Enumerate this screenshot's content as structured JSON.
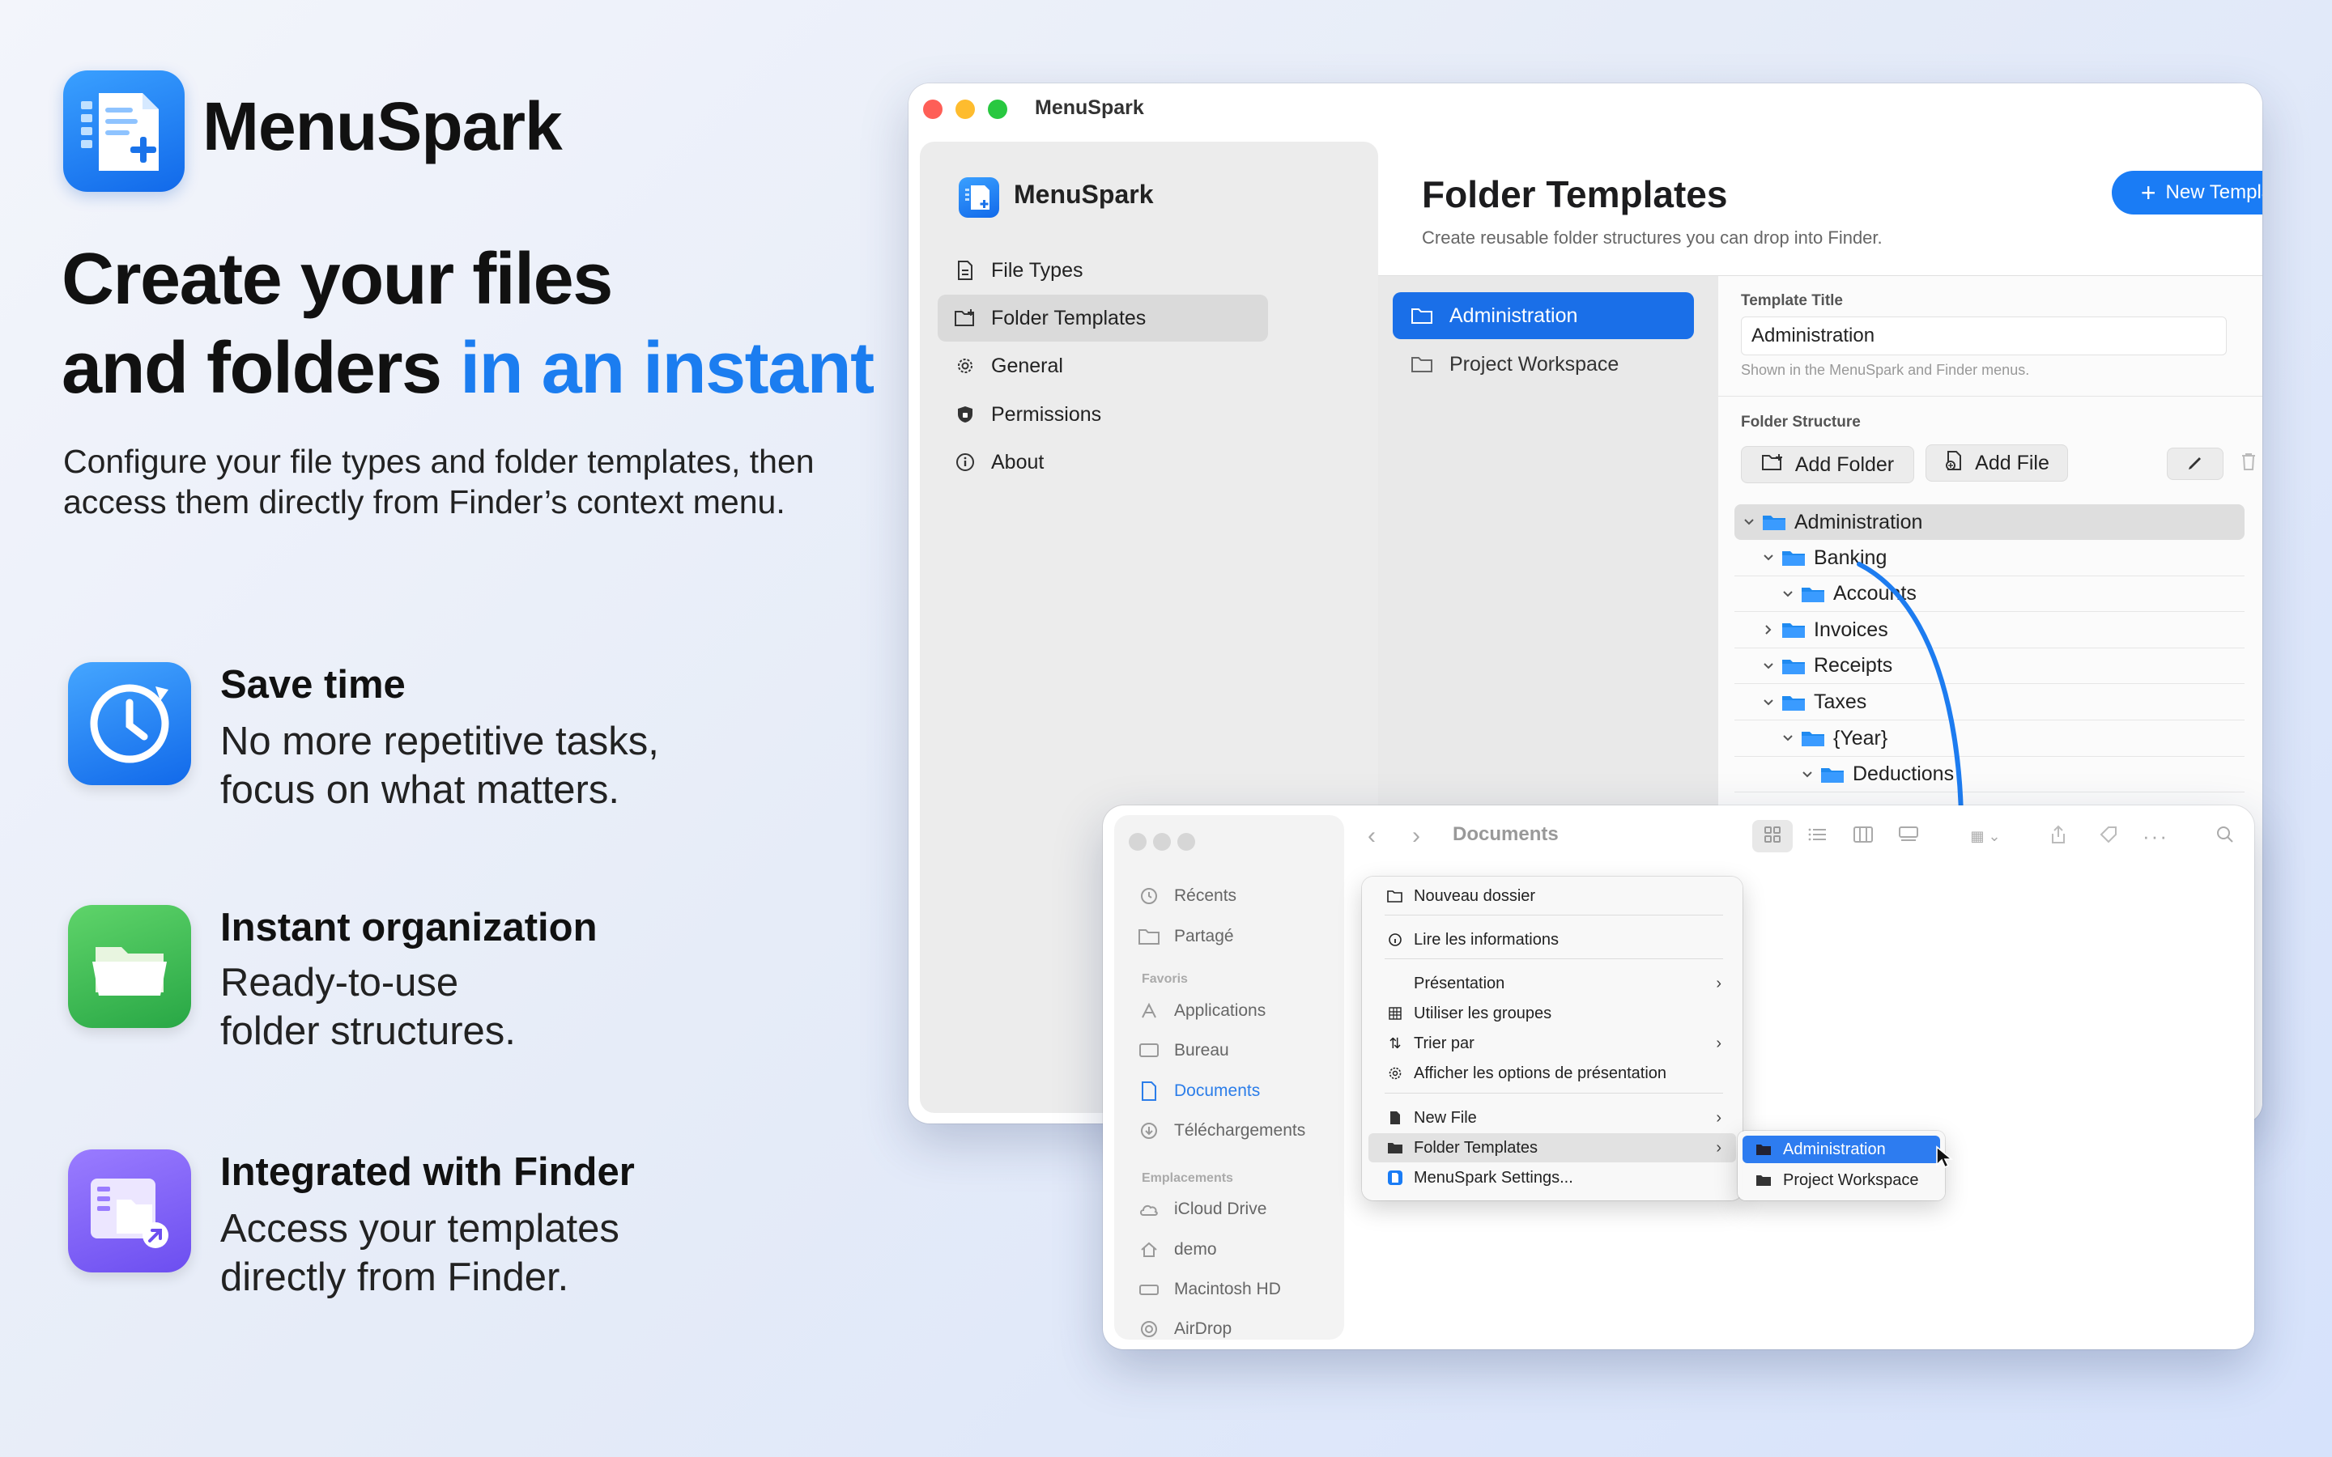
{
  "brand": {
    "name": "MenuSpark"
  },
  "headline": {
    "line1": "Create your files",
    "line2_prefix": "and folders ",
    "line2_accent": "in an instant"
  },
  "subhead": "Configure your file types and folder templates, then access them directly from Finder’s context menu.",
  "features": [
    {
      "title": "Save time",
      "desc_line1": "No more repetitive tasks,",
      "desc_line2": "focus on what matters.",
      "icon": "clock-icon"
    },
    {
      "title": "Instant organization",
      "desc_line1": "Ready-to-use",
      "desc_line2": "folder structures.",
      "icon": "folder-icon"
    },
    {
      "title": "Integrated with Finder",
      "desc_line1": "Access your templates",
      "desc_line2": "directly from Finder.",
      "icon": "finder-integration-icon"
    }
  ],
  "app_window": {
    "title": "MenuSpark",
    "sidebar": {
      "app_name": "MenuSpark",
      "items": [
        {
          "label": "File Types",
          "icon": "document-icon",
          "selected": false
        },
        {
          "label": "Folder Templates",
          "icon": "folder-plus-icon",
          "selected": true
        },
        {
          "label": "General",
          "icon": "gear-icon",
          "selected": false
        },
        {
          "label": "Permissions",
          "icon": "shield-icon",
          "selected": false
        },
        {
          "label": "About",
          "icon": "info-icon",
          "selected": false
        }
      ]
    },
    "page": {
      "title": "Folder Templates",
      "subtitle": "Create reusable folder structures you can drop into Finder.",
      "new_button": "New Template"
    },
    "templates": [
      {
        "label": "Administration",
        "selected": true
      },
      {
        "label": "Project Workspace",
        "selected": false
      }
    ],
    "detail": {
      "template_title_label": "Template Title",
      "template_title_value": "Administration",
      "template_title_hint": "Shown in the MenuSpark and Finder menus.",
      "structure_label": "Folder Structure",
      "add_folder": "Add Folder",
      "add_file": "Add File",
      "tree": [
        {
          "label": "Administration",
          "level": 0,
          "expanded": true,
          "selected": true
        },
        {
          "label": "Banking",
          "level": 1,
          "expanded": true,
          "selected": false
        },
        {
          "label": "Accounts",
          "level": 2,
          "expanded": true,
          "selected": false
        },
        {
          "label": "Invoices",
          "level": 1,
          "expanded": false,
          "selected": false
        },
        {
          "label": "Receipts",
          "level": 1,
          "expanded": true,
          "selected": false
        },
        {
          "label": "Taxes",
          "level": 1,
          "expanded": true,
          "selected": false
        },
        {
          "label": "{Year}",
          "level": 2,
          "expanded": true,
          "selected": false
        },
        {
          "label": "Deductions",
          "level": 3,
          "expanded": true,
          "selected": false
        }
      ]
    }
  },
  "finder": {
    "location": "Documents",
    "sidebar": {
      "top": [
        "Récents",
        "Partagé"
      ],
      "favorites_header": "Favoris",
      "favorites": [
        "Applications",
        "Bureau",
        "Documents",
        "Téléchargements"
      ],
      "locations_header": "Emplacements",
      "locations": [
        "iCloud Drive",
        "demo",
        "Macintosh HD",
        "AirDrop"
      ]
    },
    "context_menu": {
      "new_folder": "Nouveau dossier",
      "get_info": "Lire les informations",
      "presentation": "Présentation",
      "use_groups": "Utiliser les groupes",
      "sort_by": "Trier par",
      "view_options": "Afficher les options de présentation",
      "new_file": "New File",
      "folder_templates": "Folder Templates",
      "settings": "MenuSpark Settings..."
    },
    "submenu": [
      "Administration",
      "Project Workspace"
    ]
  },
  "colors": {
    "accent": "#1a7cf5",
    "headline_accent": "#1b7df0",
    "folder_blue": "#1f8af0"
  }
}
